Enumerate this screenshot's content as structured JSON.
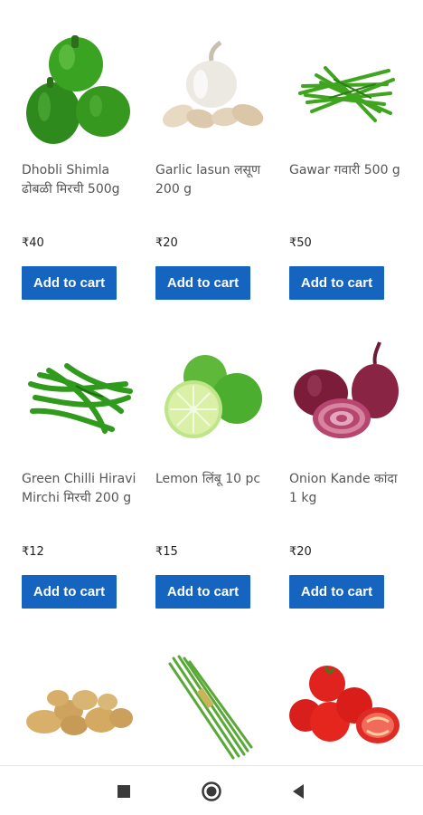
{
  "products": [
    {
      "name": "Dhobli Shimla ढोबळी मिरची 500g",
      "price": "₹40",
      "button": "Add to cart",
      "image_icon": "bell-pepper-icon"
    },
    {
      "name": "Garlic lasun लसूण 200 g",
      "price": "₹20",
      "button": "Add to cart",
      "image_icon": "garlic-icon"
    },
    {
      "name": "Gawar गवारी 500 g",
      "price": "₹50",
      "button": "Add to cart",
      "image_icon": "cluster-beans-icon"
    },
    {
      "name": "Green Chilli Hiravi Mirchi मिरची 200 g",
      "price": "₹12",
      "button": "Add to cart",
      "image_icon": "green-chilli-icon"
    },
    {
      "name": "Lemon लिंबू 10 pc",
      "price": "₹15",
      "button": "Add to cart",
      "image_icon": "lemon-icon"
    },
    {
      "name": "Onion Kande कांदा 1 kg",
      "price": "₹20",
      "button": "Add to cart",
      "image_icon": "onion-icon"
    },
    {
      "image_icon": "potato-icon"
    },
    {
      "image_icon": "spring-onion-icon"
    },
    {
      "image_icon": "tomato-icon"
    }
  ],
  "colors": {
    "button_bg": "#1565c0",
    "button_text": "#ffffff",
    "price_text": "#222222",
    "name_text": "#555555"
  },
  "nav": {
    "icons": [
      "recents-square-icon",
      "home-circle-icon",
      "back-triangle-icon"
    ]
  }
}
